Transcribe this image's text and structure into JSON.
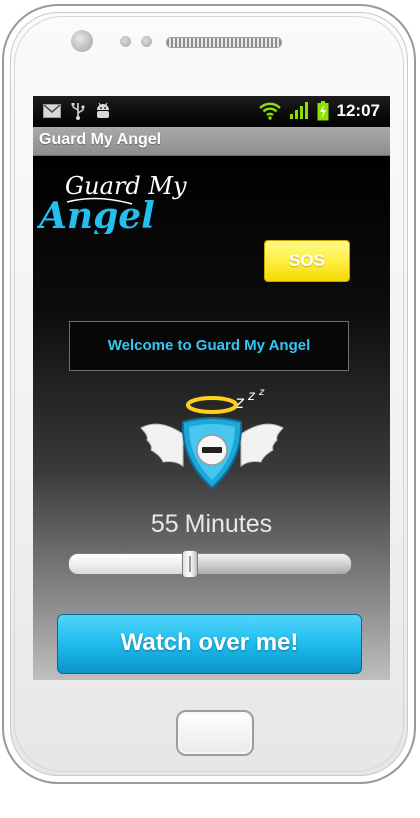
{
  "status_bar": {
    "time": "12:07",
    "icons": [
      "gmail-icon",
      "usb-icon",
      "android-debug-icon",
      "wifi-icon",
      "signal-icon",
      "battery-charging-icon"
    ]
  },
  "app": {
    "title": "Guard My Angel",
    "logo": {
      "line1": "Guard My",
      "line2": "Angel"
    }
  },
  "sos_button": {
    "label": "SOS"
  },
  "welcome_message": "Welcome to Guard My Angel",
  "angel_icon": {
    "name": "sleeping-angel-shield-icon",
    "sleep_text": "z z z"
  },
  "timer": {
    "value": "55",
    "unit": "Minutes"
  },
  "slider": {
    "fraction": 0.43
  },
  "watch_button": {
    "label": "Watch over me!"
  },
  "colors": {
    "accent": "#22bff0",
    "sos": "#fff14a",
    "welcome_text": "#31c8f5"
  }
}
